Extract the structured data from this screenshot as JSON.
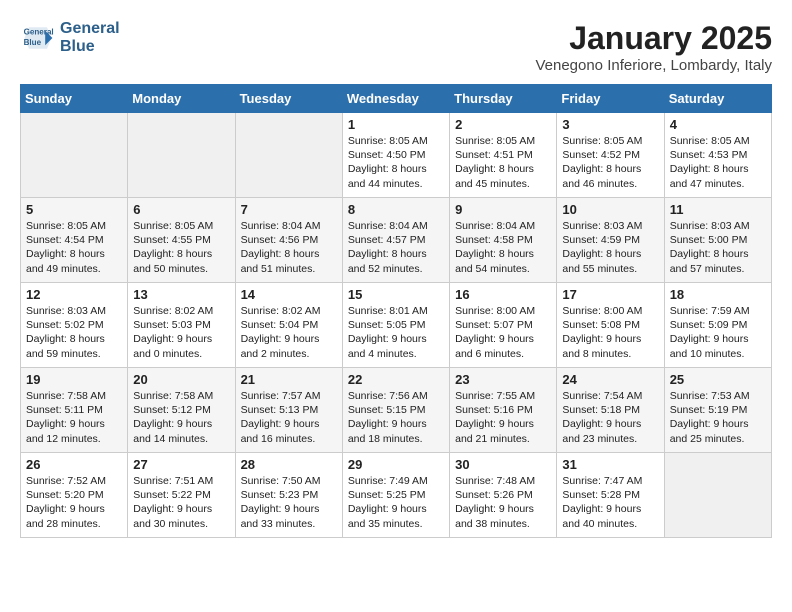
{
  "header": {
    "logo_line1": "General",
    "logo_line2": "Blue",
    "title": "January 2025",
    "subtitle": "Venegono Inferiore, Lombardy, Italy"
  },
  "weekdays": [
    "Sunday",
    "Monday",
    "Tuesday",
    "Wednesday",
    "Thursday",
    "Friday",
    "Saturday"
  ],
  "weeks": [
    [
      {
        "day": "",
        "info": ""
      },
      {
        "day": "",
        "info": ""
      },
      {
        "day": "",
        "info": ""
      },
      {
        "day": "1",
        "info": "Sunrise: 8:05 AM\nSunset: 4:50 PM\nDaylight: 8 hours\nand 44 minutes."
      },
      {
        "day": "2",
        "info": "Sunrise: 8:05 AM\nSunset: 4:51 PM\nDaylight: 8 hours\nand 45 minutes."
      },
      {
        "day": "3",
        "info": "Sunrise: 8:05 AM\nSunset: 4:52 PM\nDaylight: 8 hours\nand 46 minutes."
      },
      {
        "day": "4",
        "info": "Sunrise: 8:05 AM\nSunset: 4:53 PM\nDaylight: 8 hours\nand 47 minutes."
      }
    ],
    [
      {
        "day": "5",
        "info": "Sunrise: 8:05 AM\nSunset: 4:54 PM\nDaylight: 8 hours\nand 49 minutes."
      },
      {
        "day": "6",
        "info": "Sunrise: 8:05 AM\nSunset: 4:55 PM\nDaylight: 8 hours\nand 50 minutes."
      },
      {
        "day": "7",
        "info": "Sunrise: 8:04 AM\nSunset: 4:56 PM\nDaylight: 8 hours\nand 51 minutes."
      },
      {
        "day": "8",
        "info": "Sunrise: 8:04 AM\nSunset: 4:57 PM\nDaylight: 8 hours\nand 52 minutes."
      },
      {
        "day": "9",
        "info": "Sunrise: 8:04 AM\nSunset: 4:58 PM\nDaylight: 8 hours\nand 54 minutes."
      },
      {
        "day": "10",
        "info": "Sunrise: 8:03 AM\nSunset: 4:59 PM\nDaylight: 8 hours\nand 55 minutes."
      },
      {
        "day": "11",
        "info": "Sunrise: 8:03 AM\nSunset: 5:00 PM\nDaylight: 8 hours\nand 57 minutes."
      }
    ],
    [
      {
        "day": "12",
        "info": "Sunrise: 8:03 AM\nSunset: 5:02 PM\nDaylight: 8 hours\nand 59 minutes."
      },
      {
        "day": "13",
        "info": "Sunrise: 8:02 AM\nSunset: 5:03 PM\nDaylight: 9 hours\nand 0 minutes."
      },
      {
        "day": "14",
        "info": "Sunrise: 8:02 AM\nSunset: 5:04 PM\nDaylight: 9 hours\nand 2 minutes."
      },
      {
        "day": "15",
        "info": "Sunrise: 8:01 AM\nSunset: 5:05 PM\nDaylight: 9 hours\nand 4 minutes."
      },
      {
        "day": "16",
        "info": "Sunrise: 8:00 AM\nSunset: 5:07 PM\nDaylight: 9 hours\nand 6 minutes."
      },
      {
        "day": "17",
        "info": "Sunrise: 8:00 AM\nSunset: 5:08 PM\nDaylight: 9 hours\nand 8 minutes."
      },
      {
        "day": "18",
        "info": "Sunrise: 7:59 AM\nSunset: 5:09 PM\nDaylight: 9 hours\nand 10 minutes."
      }
    ],
    [
      {
        "day": "19",
        "info": "Sunrise: 7:58 AM\nSunset: 5:11 PM\nDaylight: 9 hours\nand 12 minutes."
      },
      {
        "day": "20",
        "info": "Sunrise: 7:58 AM\nSunset: 5:12 PM\nDaylight: 9 hours\nand 14 minutes."
      },
      {
        "day": "21",
        "info": "Sunrise: 7:57 AM\nSunset: 5:13 PM\nDaylight: 9 hours\nand 16 minutes."
      },
      {
        "day": "22",
        "info": "Sunrise: 7:56 AM\nSunset: 5:15 PM\nDaylight: 9 hours\nand 18 minutes."
      },
      {
        "day": "23",
        "info": "Sunrise: 7:55 AM\nSunset: 5:16 PM\nDaylight: 9 hours\nand 21 minutes."
      },
      {
        "day": "24",
        "info": "Sunrise: 7:54 AM\nSunset: 5:18 PM\nDaylight: 9 hours\nand 23 minutes."
      },
      {
        "day": "25",
        "info": "Sunrise: 7:53 AM\nSunset: 5:19 PM\nDaylight: 9 hours\nand 25 minutes."
      }
    ],
    [
      {
        "day": "26",
        "info": "Sunrise: 7:52 AM\nSunset: 5:20 PM\nDaylight: 9 hours\nand 28 minutes."
      },
      {
        "day": "27",
        "info": "Sunrise: 7:51 AM\nSunset: 5:22 PM\nDaylight: 9 hours\nand 30 minutes."
      },
      {
        "day": "28",
        "info": "Sunrise: 7:50 AM\nSunset: 5:23 PM\nDaylight: 9 hours\nand 33 minutes."
      },
      {
        "day": "29",
        "info": "Sunrise: 7:49 AM\nSunset: 5:25 PM\nDaylight: 9 hours\nand 35 minutes."
      },
      {
        "day": "30",
        "info": "Sunrise: 7:48 AM\nSunset: 5:26 PM\nDaylight: 9 hours\nand 38 minutes."
      },
      {
        "day": "31",
        "info": "Sunrise: 7:47 AM\nSunset: 5:28 PM\nDaylight: 9 hours\nand 40 minutes."
      },
      {
        "day": "",
        "info": ""
      }
    ]
  ]
}
